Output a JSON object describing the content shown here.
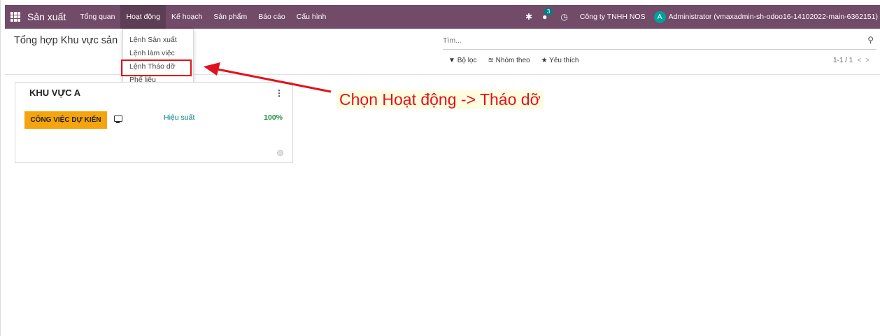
{
  "navbar": {
    "app_name": "Sản xuất",
    "menus": [
      {
        "label": "Tổng quan"
      },
      {
        "label": "Hoạt động"
      },
      {
        "label": "Kế hoạch"
      },
      {
        "label": "Sản phẩm"
      },
      {
        "label": "Báo cáo"
      },
      {
        "label": "Cấu hình"
      }
    ],
    "message_count": "3",
    "company": "Công ty TNHH NOS",
    "avatar_letter": "A",
    "user": "Administrator (vmaxadmin-sh-odoo16-14102022-main-6362151)"
  },
  "dropdown": {
    "items": [
      {
        "label": "Lệnh Sản xuất"
      },
      {
        "label": "Lệnh làm việc"
      },
      {
        "label": "Lệnh Tháo dỡ"
      },
      {
        "label": "Phế liệu"
      }
    ]
  },
  "control": {
    "breadcrumb": "Tổng hợp Khu vực sản",
    "search_placeholder": "Tìm...",
    "filters": "Bộ lọc",
    "group_by": "Nhóm theo",
    "favorites": "Yêu thích",
    "pager": "1-1 / 1"
  },
  "card": {
    "title": "KHU VỰC A",
    "button": "CÔNG VIỆC DỰ KIẾN",
    "perf_label": "Hiệu suất",
    "perf_value": "100%"
  },
  "annotation": {
    "text": "Chọn Hoạt động -> Tháo dỡ",
    "color": "#e1121c"
  },
  "colors": {
    "navbar": "#714b67",
    "button": "#f4a40c",
    "link": "#017e84"
  }
}
